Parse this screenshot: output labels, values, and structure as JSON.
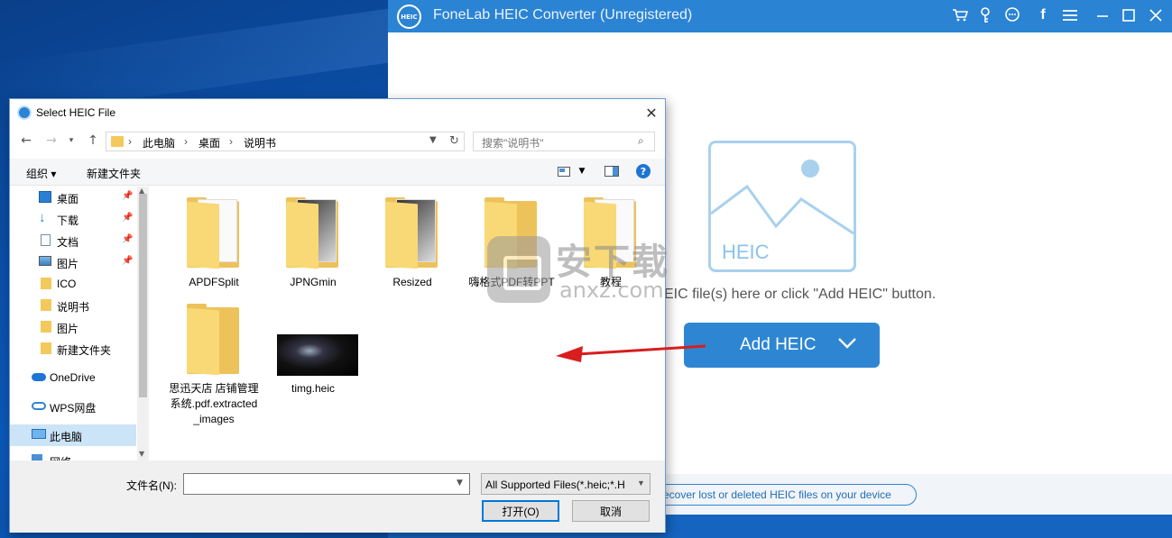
{
  "app": {
    "title": "FoneLab HEIC Converter (Unregistered)",
    "logo_text": "HEIC",
    "title_icons": [
      "cart-icon",
      "key-icon",
      "chat-icon",
      "facebook-icon",
      "menu-icon",
      "minimize-icon",
      "maximize-icon",
      "close-icon"
    ],
    "drop_placeholder_label": "HEIC",
    "drop_hint": "EIC file(s) here or click \"Add HEIC\" button.",
    "add_button_label": "Add HEIC",
    "recover_link": "ecover lost or deleted HEIC files on your device",
    "colors": {
      "accent": "#2e86d2",
      "titlebar": "#2b83d4",
      "placeholder": "#a9d1ee"
    }
  },
  "dialog": {
    "title": "Select HEIC File",
    "breadcrumb": [
      "此电脑",
      "桌面",
      "说明书"
    ],
    "search_placeholder": "搜索\"说明书\"",
    "toolbar": {
      "organize": "组织 ▾",
      "new_folder": "新建文件夹"
    },
    "sidebar": [
      {
        "label": "桌面",
        "icon": "desktop-icon",
        "pinned": true
      },
      {
        "label": "下载",
        "icon": "download-icon",
        "pinned": true
      },
      {
        "label": "文档",
        "icon": "document-icon",
        "pinned": true
      },
      {
        "label": "图片",
        "icon": "pictures-icon",
        "pinned": true
      },
      {
        "label": "ICO",
        "icon": "folder-icon",
        "pinned": false
      },
      {
        "label": "说明书",
        "icon": "folder-icon",
        "pinned": false
      },
      {
        "label": "图片",
        "icon": "folder-icon",
        "pinned": false
      },
      {
        "label": "新建文件夹",
        "icon": "folder-icon",
        "pinned": false
      },
      {
        "label": "OneDrive",
        "icon": "cloud-icon",
        "pinned": false
      },
      {
        "label": "WPS网盘",
        "icon": "cloud-icon",
        "pinned": false
      },
      {
        "label": "此电脑",
        "icon": "computer-icon",
        "pinned": false,
        "selected": true
      },
      {
        "label": "网络",
        "icon": "network-icon",
        "pinned": false
      }
    ],
    "files": [
      {
        "name": "APDFSplit",
        "kind": "folder"
      },
      {
        "name": "JPNGmin",
        "kind": "folder"
      },
      {
        "name": "Resized",
        "kind": "folder"
      },
      {
        "name": "嗨格式PDF转PPT",
        "kind": "folder"
      },
      {
        "name": "教程",
        "kind": "folder"
      },
      {
        "name": "思迅天店 店铺管理系统.pdf.extracted_images",
        "kind": "folder"
      },
      {
        "name": "timg.heic",
        "kind": "image"
      }
    ],
    "filename_label": "文件名(N):",
    "filename_value": "",
    "filetype": "All Supported Files(*.heic;*.H",
    "open_button": "打开(O)",
    "cancel_button": "取消"
  },
  "watermark": {
    "big": "安下载",
    "small": "anxz.com"
  }
}
